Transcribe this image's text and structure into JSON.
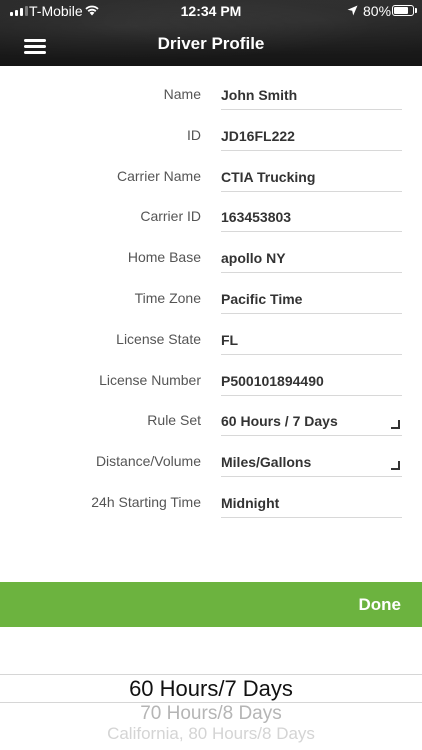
{
  "status_bar": {
    "carrier": "T-Mobile",
    "time": "12:34 PM",
    "battery_percent": "80%",
    "battery_level": 0.8,
    "icons": [
      "signal-icon",
      "wifi-icon",
      "location-arrow-icon",
      "battery-icon"
    ]
  },
  "header": {
    "title": "Driver Profile",
    "menu_icon": "hamburger-menu-icon"
  },
  "form": {
    "fields": [
      {
        "label": "Name",
        "value": "John Smith"
      },
      {
        "label": "ID",
        "value": "JD16FL222"
      },
      {
        "label": "Carrier Name",
        "value": "CTIA Trucking"
      },
      {
        "label": "Carrier ID",
        "value": "163453803"
      },
      {
        "label": "Home Base",
        "value": "apollo NY"
      },
      {
        "label": "Time Zone",
        "value": "Pacific Time"
      },
      {
        "label": "License State",
        "value": "FL"
      },
      {
        "label": "License Number",
        "value": "P500101894490"
      },
      {
        "label": "Rule Set",
        "value": "60 Hours / 7 Days"
      },
      {
        "label": "Distance/Volume",
        "value": "Miles/Gallons"
      },
      {
        "label": "24h Starting Time",
        "value": "Midnight"
      }
    ]
  },
  "done_bar": {
    "done_label": "Done"
  },
  "picker": {
    "options": [
      "60 Hours/7 Days",
      "70 Hours/8 Days",
      "California, 80 Hours/8 Days"
    ],
    "selected": "60 Hours/7 Days"
  },
  "colors": {
    "accent_green": "#6cb33f",
    "header_dark": "#1e1e1e"
  }
}
